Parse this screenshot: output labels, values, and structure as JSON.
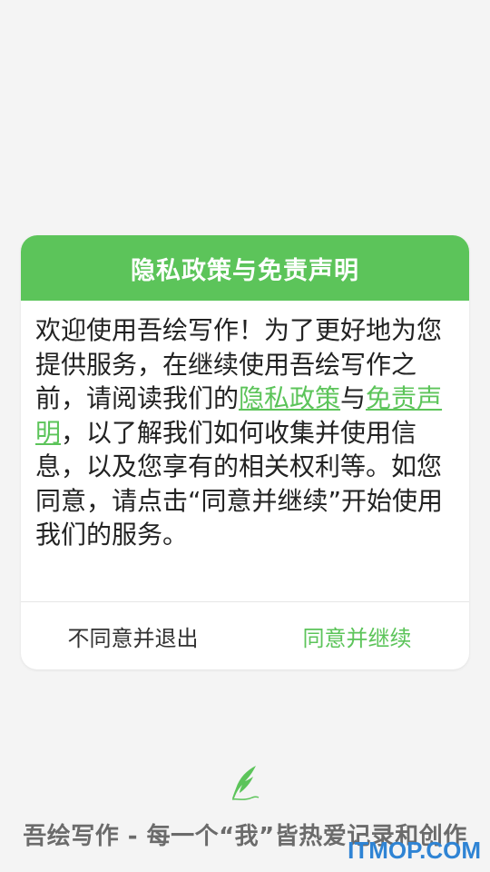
{
  "dialog": {
    "title": "隐私政策与免责声明",
    "body": {
      "part1": "欢迎使用吾绘写作！为了更好地为您提供服务，在继续使用吾绘写作之前，请阅读我们的",
      "link_privacy": "隐私政策",
      "conj": "与",
      "link_disclaimer": "免责声明",
      "part2": "，以了解我们如何收集并使用信息，以及您享有的相关权利等。如您同意，请点击“同意并继续”开始使用我们的服务。"
    },
    "decline_label": "不同意并退出",
    "accept_label": "同意并继续"
  },
  "footer": {
    "logo_icon": "quill-feather-icon",
    "slogan": "吾绘写作 - 每一个“我”皆热爱记录和创作"
  },
  "watermark": "ITMOP.COM",
  "colors": {
    "accent": "#5cc45a",
    "background": "#f4f4f4",
    "watermark": "#2f84d4"
  }
}
